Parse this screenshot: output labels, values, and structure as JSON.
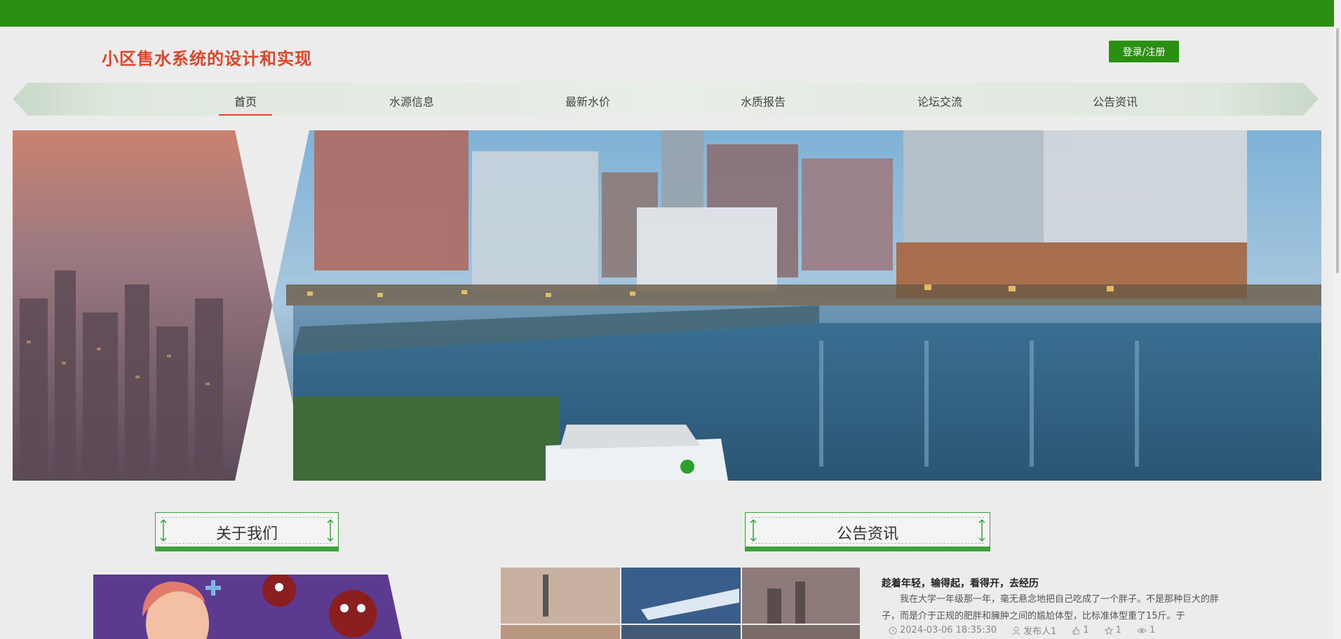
{
  "header": {
    "site_title": "小区售水系统的设计和实现",
    "login_label": "登录/注册"
  },
  "nav": {
    "items": [
      {
        "label": "首页",
        "active": true
      },
      {
        "label": "水源信息"
      },
      {
        "label": "最新水价"
      },
      {
        "label": "水质报告"
      },
      {
        "label": "论坛交流"
      },
      {
        "label": "公告资讯"
      }
    ]
  },
  "sections": {
    "about_title": "关于我们",
    "news_title": "公告资讯"
  },
  "news": {
    "title": "趁着年轻，输得起，看得开，去经历",
    "body": "我在大学一年级那一年，毫无悬念地把自己吃成了一个胖子。不是那种巨大的胖子，而是介于正规的肥胖和臃肿之间的尴尬体型，比标准体型重了15斤。于",
    "date": "2024-03-06 18:35:30",
    "author": "发布人1",
    "likes": "1",
    "favorites": "1",
    "views": "1"
  },
  "colors": {
    "brand_green": "#2b8f12",
    "title_red": "#e0452a"
  },
  "icons": [
    "clock-icon",
    "user-icon",
    "thumb-up-icon",
    "star-icon",
    "eye-icon"
  ]
}
